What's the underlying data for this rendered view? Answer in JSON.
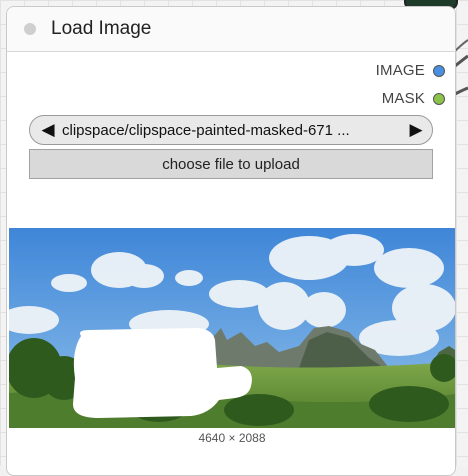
{
  "node": {
    "title": "Load Image",
    "outputs": [
      {
        "label": "IMAGE",
        "color": "#4a90e2"
      },
      {
        "label": "MASK",
        "color": "#8bc34a"
      }
    ],
    "image_selector": {
      "value": "clipspace/clipspace-painted-masked-671 ...",
      "prev_icon": "triangle-left-icon",
      "next_icon": "triangle-right-icon"
    },
    "upload_button_label": "choose file to upload",
    "image_dimensions": "4640 × 2088"
  },
  "colors": {
    "image_output": "#4a90e2",
    "mask_output": "#8bc34a"
  }
}
